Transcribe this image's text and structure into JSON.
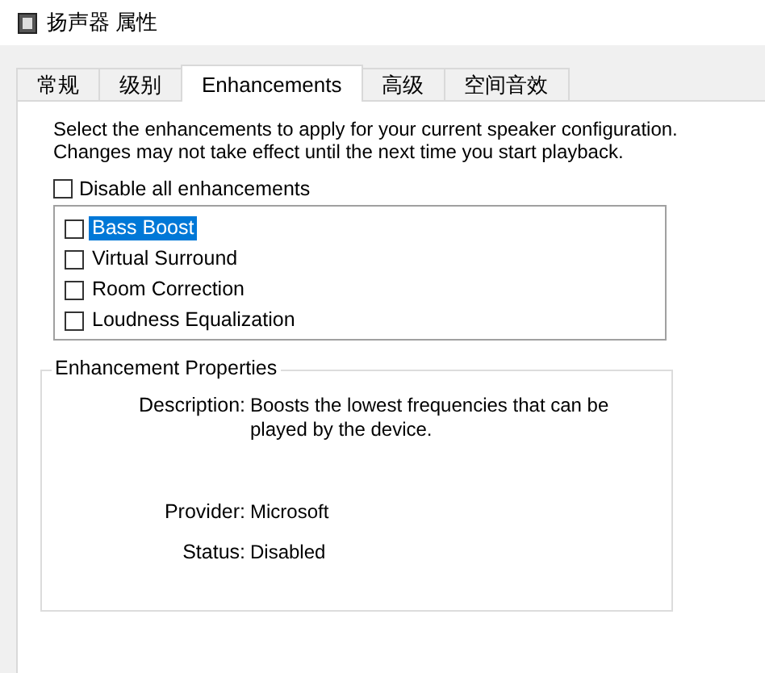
{
  "window": {
    "title": "扬声器 属性"
  },
  "tabs": [
    {
      "label": "常规",
      "selected": false
    },
    {
      "label": "级别",
      "selected": false
    },
    {
      "label": "Enhancements",
      "selected": true
    },
    {
      "label": "高级",
      "selected": false
    },
    {
      "label": "空间音效",
      "selected": false
    }
  ],
  "intro": "Select the enhancements to apply for your current speaker configuration. Changes may not take effect until the next time you start playback.",
  "disable_all": {
    "label": "Disable all enhancements",
    "checked": false
  },
  "enhancements": [
    {
      "label": "Bass Boost",
      "checked": false,
      "selected": true
    },
    {
      "label": "Virtual Surround",
      "checked": false,
      "selected": false
    },
    {
      "label": "Room Correction",
      "checked": false,
      "selected": false
    },
    {
      "label": "Loudness Equalization",
      "checked": false,
      "selected": false
    }
  ],
  "properties": {
    "title": "Enhancement Properties",
    "rows": [
      {
        "label": "Description:",
        "value": "Boosts the lowest frequencies that can be played by the device."
      },
      {
        "label": "Provider:",
        "value": "Microsoft"
      },
      {
        "label": "Status:",
        "value": "Disabled"
      }
    ]
  }
}
